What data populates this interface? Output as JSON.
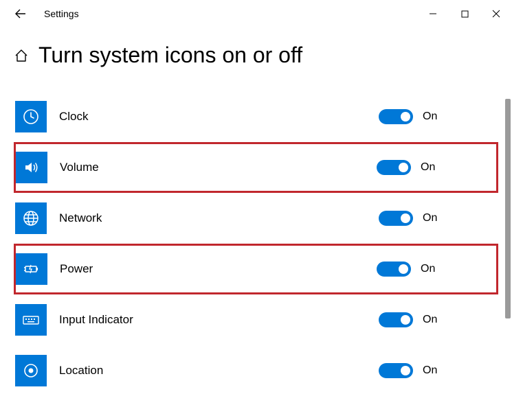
{
  "window": {
    "title": "Settings"
  },
  "page": {
    "title": "Turn system icons on or off"
  },
  "items": [
    {
      "id": "clock",
      "label": "Clock",
      "state_label": "On",
      "highlighted": false
    },
    {
      "id": "volume",
      "label": "Volume",
      "state_label": "On",
      "highlighted": true
    },
    {
      "id": "network",
      "label": "Network",
      "state_label": "On",
      "highlighted": false
    },
    {
      "id": "power",
      "label": "Power",
      "state_label": "On",
      "highlighted": true
    },
    {
      "id": "input-indicator",
      "label": "Input Indicator",
      "state_label": "On",
      "highlighted": false
    },
    {
      "id": "location",
      "label": "Location",
      "state_label": "On",
      "highlighted": false
    }
  ]
}
